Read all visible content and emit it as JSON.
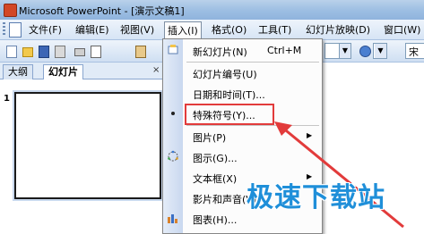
{
  "window": {
    "title": "Microsoft PowerPoint - [演示文稿1]"
  },
  "menubar": {
    "items": [
      "文件(F)",
      "编辑(E)",
      "视图(V)",
      "插入(I)",
      "格式(O)",
      "工具(T)",
      "幻灯片放映(D)",
      "窗口(W)"
    ],
    "active": "插入(I)"
  },
  "toolbar": {
    "right_text": "宋"
  },
  "pane": {
    "tabs": [
      "大纲",
      "幻灯片"
    ],
    "active_tab": "幻灯片",
    "close_glyph": "×",
    "slide_number": "1"
  },
  "insert_menu": {
    "items": [
      {
        "label": "新幻灯片(N)",
        "shortcut": "Ctrl+M",
        "icon": "new-slide-icon"
      },
      {
        "label": "幻灯片编号(U)"
      },
      {
        "label": "日期和时间(T)..."
      },
      {
        "label": "特殊符号(Y)...",
        "icon": "bullet-icon",
        "highlighted": true
      },
      {
        "label": "图片(P)",
        "submenu": true
      },
      {
        "label": "图示(G)...",
        "icon": "diagram-icon"
      },
      {
        "label": "文本框(X)",
        "submenu": true
      },
      {
        "label": "影片和声音(V)"
      },
      {
        "label": "图表(H)...",
        "icon": "chart-icon"
      }
    ],
    "submenu_glyph": "▶"
  },
  "annotation": {
    "highlight_color": "#e23b3b",
    "arrow_color": "#e23b3b"
  },
  "watermark": {
    "text": "极速下载站",
    "color": "#1f8fd9"
  }
}
